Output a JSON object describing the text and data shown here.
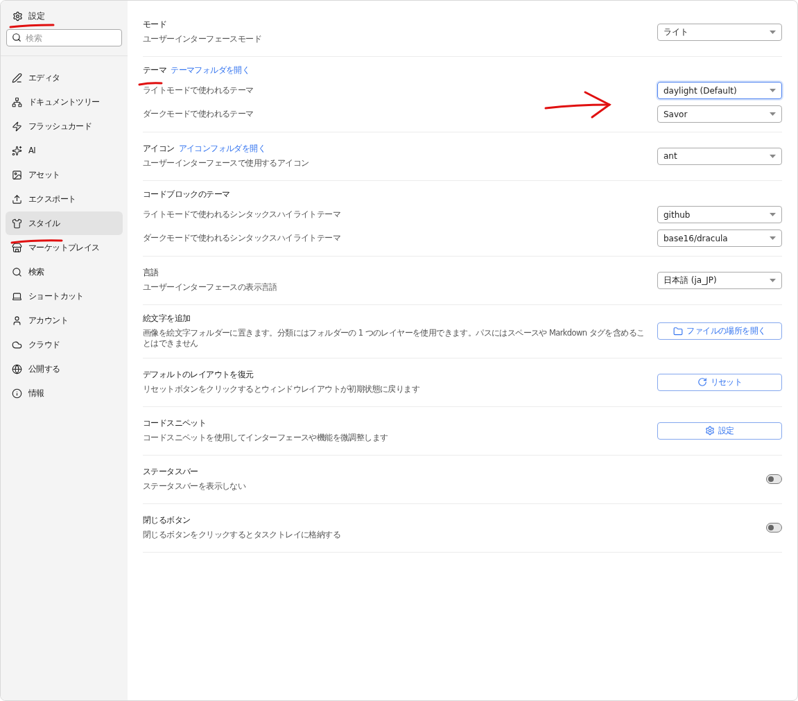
{
  "sidebar": {
    "title": "設定",
    "search": {
      "placeholder": "検索"
    },
    "items": [
      {
        "label": "エディタ",
        "selected": false
      },
      {
        "label": "ドキュメントツリー",
        "selected": false
      },
      {
        "label": "フラッシュカード",
        "selected": false
      },
      {
        "label": "AI",
        "selected": false
      },
      {
        "label": "アセット",
        "selected": false
      },
      {
        "label": "エクスポート",
        "selected": false
      },
      {
        "label": "スタイル",
        "selected": true
      },
      {
        "label": "マーケットプレイス",
        "selected": false
      },
      {
        "label": "検索",
        "selected": false
      },
      {
        "label": "ショートカット",
        "selected": false
      },
      {
        "label": "アカウント",
        "selected": false
      },
      {
        "label": "クラウド",
        "selected": false
      },
      {
        "label": "公開する",
        "selected": false
      },
      {
        "label": "情報",
        "selected": false
      }
    ]
  },
  "sections": [
    {
      "title": "モード",
      "description": "ユーザーインターフェースモード",
      "control": {
        "kind": "select",
        "value": "ライト",
        "focused": false
      }
    },
    {
      "title": "テーマ",
      "link": "テーマフォルダを開く",
      "rows": [
        {
          "label": "ライトモードで使われるテーマ",
          "control": {
            "kind": "select",
            "value": "daylight (Default)",
            "focused": true
          }
        },
        {
          "label": "ダークモードで使われるテーマ",
          "control": {
            "kind": "select",
            "value": "Savor",
            "focused": false
          }
        }
      ]
    },
    {
      "title": "アイコン",
      "link": "アイコンフォルダを開く",
      "description": "ユーザーインターフェースで使用するアイコン",
      "control": {
        "kind": "select",
        "value": "ant",
        "focused": false
      }
    },
    {
      "title": "コードブロックのテーマ",
      "rows": [
        {
          "label": "ライトモードで使われるシンタックスハイライトテーマ",
          "control": {
            "kind": "select",
            "value": "github",
            "focused": false
          }
        },
        {
          "label": "ダークモードで使われるシンタックスハイライトテーマ",
          "control": {
            "kind": "select",
            "value": "base16/dracula",
            "focused": false
          }
        }
      ]
    },
    {
      "title": "言語",
      "description": "ユーザーインターフェースの表示言語",
      "control": {
        "kind": "select",
        "value": "日本語 (ja_JP)",
        "focused": false
      }
    },
    {
      "title": "絵文字を追加",
      "description": "画像を絵文字フォルダーに置きます。分類にはフォルダーの 1 つのレイヤーを使用できます。パスにはスペースや Markdown タグを含めることはできません",
      "control": {
        "kind": "button",
        "label": "ファイルの場所を開く"
      }
    },
    {
      "title": "デフォルトのレイアウトを復元",
      "description": "リセットボタンをクリックするとウィンドウレイアウトが初期状態に戻ります",
      "control": {
        "kind": "button",
        "label": "リセット"
      }
    },
    {
      "title": "コードスニペット",
      "description": "コードスニペットを使用してインターフェースや機能を微調整します",
      "control": {
        "kind": "button",
        "label": "設定"
      }
    },
    {
      "title": "ステータスバー",
      "description": "ステータスバーを表示しない",
      "control": {
        "kind": "toggle",
        "on": false
      }
    },
    {
      "title": "閉じるボタン",
      "description": "閉じるボタンをクリックするとタスクトレイに格納する",
      "control": {
        "kind": "toggle",
        "on": false
      }
    }
  ]
}
